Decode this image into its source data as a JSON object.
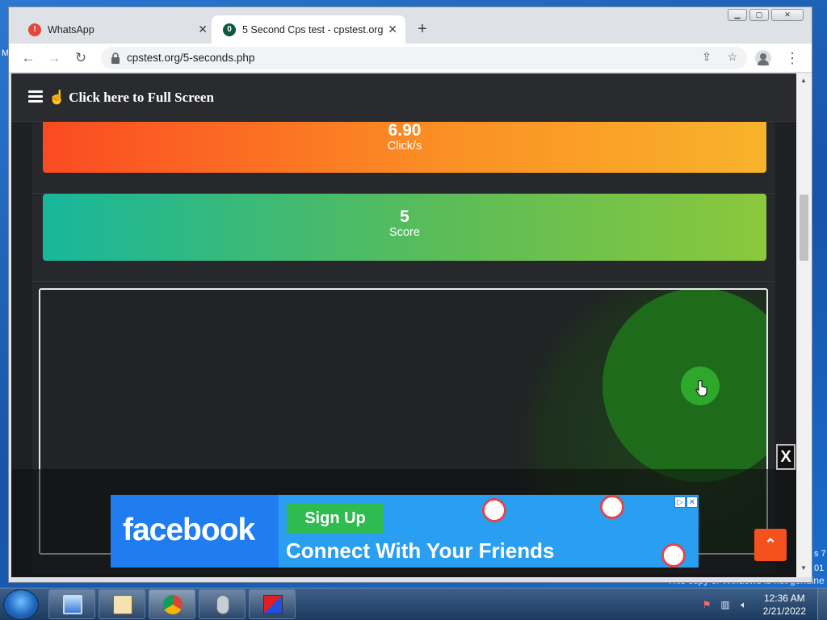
{
  "browser": {
    "tabs": [
      {
        "title": "WhatsApp",
        "icon": "whatsapp-alert-icon"
      },
      {
        "title": "5 Second Cps test - cpstest.org",
        "icon": "cpstest-favicon-icon",
        "active": true
      }
    ],
    "url": "cpstest.org/5-seconds.php",
    "window_controls": {
      "minimize": "minimize-icon",
      "maximize": "maximize-icon",
      "close": "close-icon"
    }
  },
  "site": {
    "fullscreen_label": "Click here to Full Screen",
    "cps": {
      "value": "6.90",
      "label": "Click/s"
    },
    "score": {
      "value": "5",
      "label": "Score"
    }
  },
  "ad": {
    "brand": "facebook",
    "cta": "Sign Up",
    "tagline": "Connect With Your Friends",
    "close": "X"
  },
  "desktop": {
    "fragment_left": "M",
    "fragment_right_1": "s 7",
    "fragment_right_2": "01",
    "genuine_notice": "This copy of Windows is not genuine"
  },
  "taskbar": {
    "time": "12:36 AM",
    "date": "2/21/2022"
  },
  "colors": {
    "cps_gradient": [
      "#fb4a22",
      "#f8b32b"
    ],
    "score_gradient": [
      "#17b79c",
      "#8bc83c"
    ],
    "ripple": "#2ea82a",
    "back_to_top": "#f4511e",
    "facebook_blue": "#1877f2"
  }
}
